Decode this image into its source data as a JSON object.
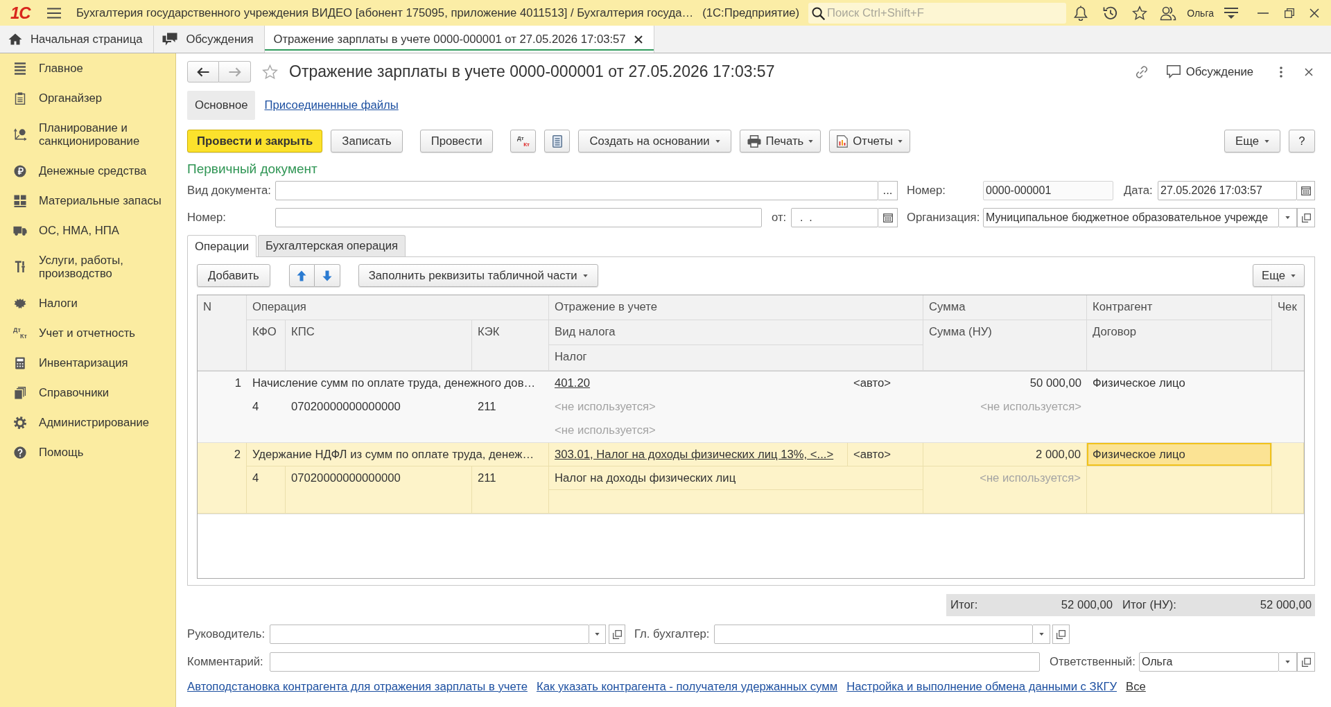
{
  "app_bar": {
    "logo": "1С",
    "title": "Бухгалтерия государственного учреждения ВИДЕО [абонент 175095, приложение 4011513] / Бухгалтерия госуда…",
    "platform": "(1С:Предприятие)",
    "search": {
      "placeholder": "Поиск Ctrl+Shift+F"
    },
    "user": "Ольга"
  },
  "open_tabs": [
    {
      "kind": "home",
      "label": "Начальная страница",
      "selected": false
    },
    {
      "kind": "discussions",
      "label": "Обсуждения",
      "selected": false
    },
    {
      "kind": "document",
      "label": "Отражение зарплаты в учете 0000-000001 от 27.05.2026 17:03:57",
      "selected": true
    }
  ],
  "sidebar": {
    "items": [
      {
        "label": "Главное",
        "selected": false
      },
      {
        "label": "Органайзер",
        "selected": false
      },
      {
        "label": "Планирование и санкционирование",
        "selected": false
      },
      {
        "label": "Денежные средства",
        "selected": false
      },
      {
        "label": "Материальные запасы",
        "selected": false
      },
      {
        "label": "ОС, НМА, НПА",
        "selected": false
      },
      {
        "label": "Услуги, работы, производство",
        "selected": false
      },
      {
        "label": "Налоги",
        "selected": false
      },
      {
        "label": "Учет и отчетность",
        "selected": false,
        "icon_text": {
          "top": "Дт",
          "bottom": "Кт"
        }
      },
      {
        "label": "Инвентаризация",
        "selected": false
      },
      {
        "label": "Справочники",
        "selected": false
      },
      {
        "label": "Администрирование",
        "selected": false
      },
      {
        "label": "Помощь",
        "selected": false
      }
    ]
  },
  "form": {
    "navigation": [
      {
        "kind": "back",
        "disabled": false
      },
      {
        "kind": "forward",
        "disabled": true
      }
    ],
    "favorite": false,
    "title": "Отражение зарплаты в учете 0000-000001 от 27.05.2026 17:03:57",
    "discussion": "Обсуждение",
    "tabs": [
      {
        "label": "Основное",
        "selected": true
      },
      {
        "label": "Присоединенные файлы",
        "selected": false
      }
    ]
  },
  "command_bar": {
    "groups": [
      {
        "buttons": [
          {
            "kind": "default",
            "label": "Провести и закрыть",
            "dropdown": false
          },
          {
            "kind": "text",
            "label": "Записать",
            "dropdown": false
          }
        ]
      },
      {
        "buttons": [
          {
            "kind": "text",
            "label": "Провести",
            "dropdown": false
          }
        ]
      },
      {
        "buttons": [
          {
            "kind": "debit_credit",
            "top": "Дт",
            "bottom": "Кт",
            "dropdown": false
          },
          {
            "kind": "list",
            "dropdown": false
          },
          {
            "kind": "text",
            "label": "Создать на основании",
            "dropdown": true
          },
          {
            "kind": "print",
            "label": "Печать",
            "dropdown": true
          },
          {
            "kind": "reports",
            "label": "Отчеты",
            "dropdown": true
          }
        ]
      }
    ],
    "more": "Еще",
    "help": "?"
  },
  "primary_document": {
    "title": "Первичный документ",
    "doc_type": {
      "label": "Вид документа:",
      "button": "..."
    },
    "number": {
      "label": "Номер:",
      "value": "0000-000001"
    },
    "date": {
      "label": "Дата:",
      "value": "27.05.2026 17:03:57"
    },
    "source_number": {
      "label": "Номер:"
    },
    "source_date": {
      "label": "от:",
      "value": ".  ."
    },
    "organization": {
      "label": "Организация:",
      "value": "Муниципальное бюджетное образовательное учрежде"
    }
  },
  "doc_tabs": [
    {
      "label": "Операции",
      "selected": true
    },
    {
      "label": "Бухгалтерская операция",
      "selected": false
    }
  ],
  "table_toolbar": {
    "add": "Добавить",
    "fill": "Заполнить реквизиты табличной части",
    "more": "Еще"
  },
  "table": {
    "header": {
      "n": "N",
      "operation": "Операция",
      "kfo": "КФО",
      "kps": "КПС",
      "kek": "КЭК",
      "reflection": "Отражение в учете",
      "tax_type": "Вид налога",
      "tax": "Налог",
      "sum": "Сумма",
      "sum_tax": "Сумма (НУ)",
      "counterparty": "Контрагент",
      "contract": "Договор",
      "check": "Чек"
    },
    "rows": [
      {
        "n": "1",
        "selected": false,
        "operation": "Начисление сумм по оплате труда, денежного дов…",
        "kfo": "4",
        "kps": "07020000000000000",
        "kek": "211",
        "account": "401.20",
        "account_mode": "<авто>",
        "tax_type": {
          "text": "<не используется>",
          "muted": true
        },
        "tax": {
          "text": "<не используется>",
          "muted": true
        },
        "sum": "50 000,00",
        "sum_tax": {
          "text": "<не используется>",
          "muted": true
        },
        "counterparty": {
          "text": "Физическое лицо",
          "focused": false
        }
      },
      {
        "n": "2",
        "selected": true,
        "operation": "Удержание НДФЛ из сумм по оплате труда, денеж…",
        "kfo": "4",
        "kps": "07020000000000000",
        "kek": "211",
        "account": "303.01, Налог на доходы физических лиц 13%, <...>",
        "account_mode": "<авто>",
        "tax_type": {
          "text": "Налог на доходы физических лиц",
          "muted": false
        },
        "sum": "2 000,00",
        "sum_tax": {
          "text": "<не используется>",
          "muted": true
        },
        "counterparty": {
          "text": "Физическое лицо",
          "focused": true
        }
      }
    ]
  },
  "totals": {
    "total_label": "Итог:",
    "total": "52 000,00",
    "total_tax_label": "Итог (НУ):",
    "total_tax": "52 000,00"
  },
  "signatures": {
    "head": {
      "label": "Руководитель:"
    },
    "chief_accountant": {
      "label": "Гл. бухгалтер:"
    },
    "comment": {
      "label": "Комментарий:"
    },
    "responsible": {
      "label": "Ответственный:",
      "value": "Ольга"
    }
  },
  "links": [
    {
      "kind": "help",
      "label": "Автоподстановка контрагента для отражения зарплаты в учете"
    },
    {
      "kind": "help",
      "label": "Как указать контрагента - получателя удержанных сумм"
    },
    {
      "kind": "help",
      "label": "Настройка и выполнение обмена данными с ЗКГУ"
    },
    {
      "kind": "all",
      "label": "Все"
    }
  ]
}
